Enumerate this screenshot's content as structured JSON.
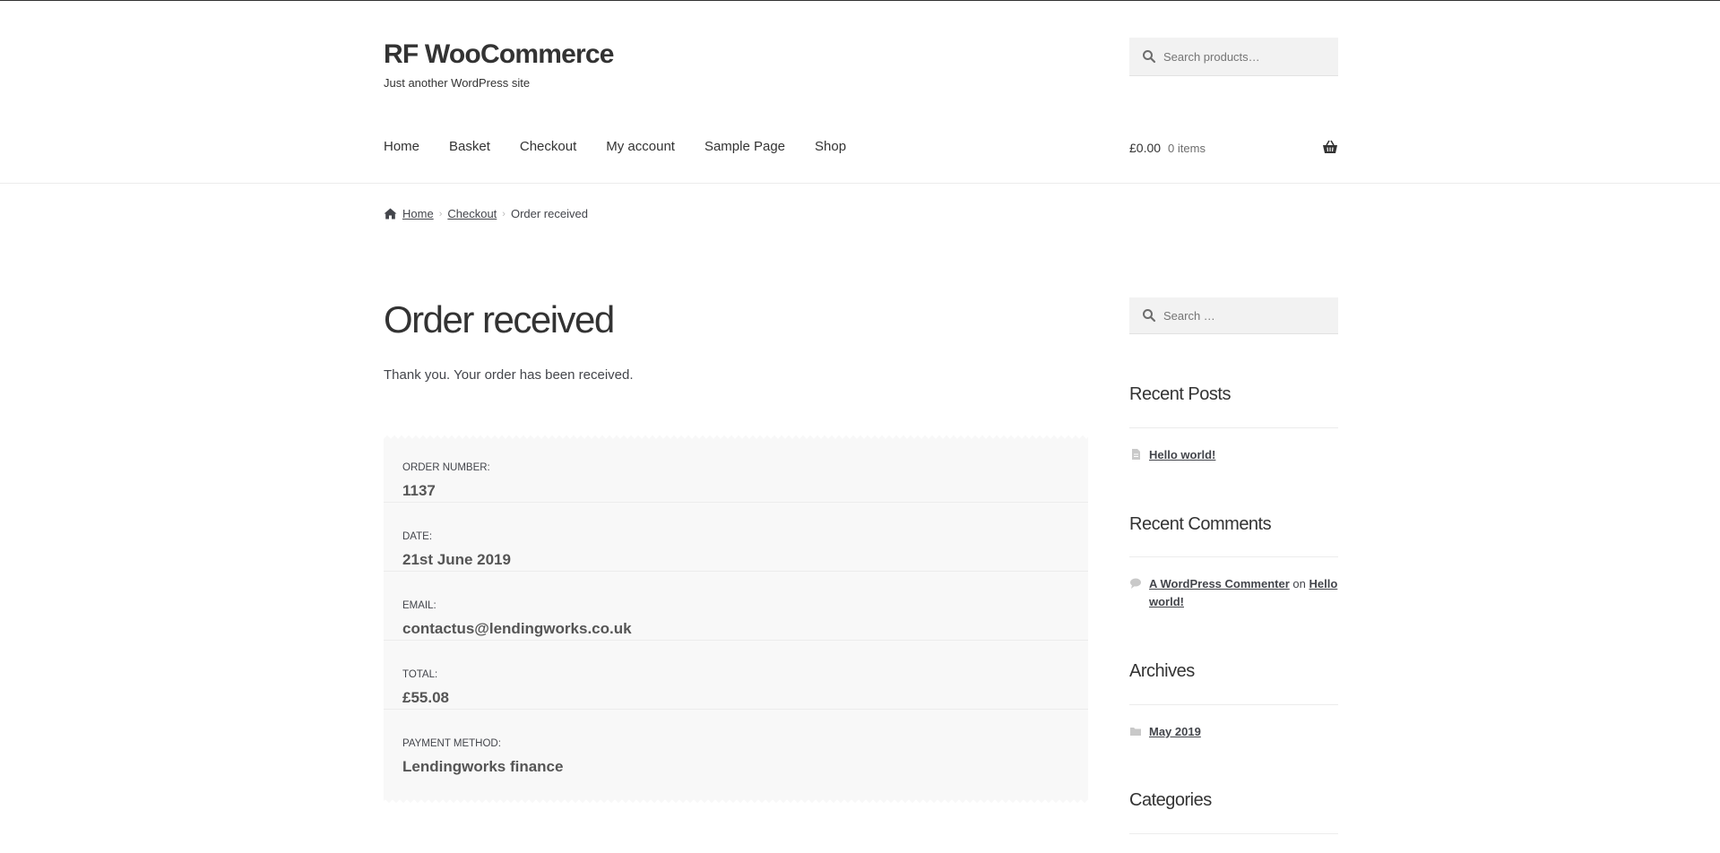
{
  "header": {
    "site_title": "RF WooCommerce",
    "tagline": "Just another WordPress site",
    "search_placeholder": "Search products…"
  },
  "nav": {
    "items": [
      "Home",
      "Basket",
      "Checkout",
      "My account",
      "Sample Page",
      "Shop"
    ]
  },
  "cart": {
    "amount": "£0.00",
    "count": "0 items",
    "icon": "basket-icon"
  },
  "breadcrumb": {
    "home": "Home",
    "checkout": "Checkout",
    "current": "Order received"
  },
  "page": {
    "title": "Order received",
    "thankyou": "Thank you. Your order has been received."
  },
  "order": {
    "rows": [
      {
        "label": "Order number:",
        "value": "1137"
      },
      {
        "label": "Date:",
        "value": "21st June 2019"
      },
      {
        "label": "Email:",
        "value": "contactus@lendingworks.co.uk"
      },
      {
        "label": "Total:",
        "value": "£55.08"
      },
      {
        "label": "Payment method:",
        "value": "Lendingworks finance"
      }
    ]
  },
  "sidebar": {
    "search_placeholder": "Search …",
    "recent_posts": {
      "title": "Recent Posts",
      "items": [
        "Hello world!"
      ]
    },
    "recent_comments": {
      "title": "Recent Comments",
      "author": "A WordPress Commenter",
      "on": "on",
      "post": "Hello world!"
    },
    "archives": {
      "title": "Archives",
      "items": [
        "May 2019"
      ]
    },
    "categories": {
      "title": "Categories"
    }
  },
  "colors": {
    "text": "#43454b",
    "heading": "#333333",
    "box_bg": "#f8f8f8",
    "search_bg": "#f2f2f2"
  }
}
